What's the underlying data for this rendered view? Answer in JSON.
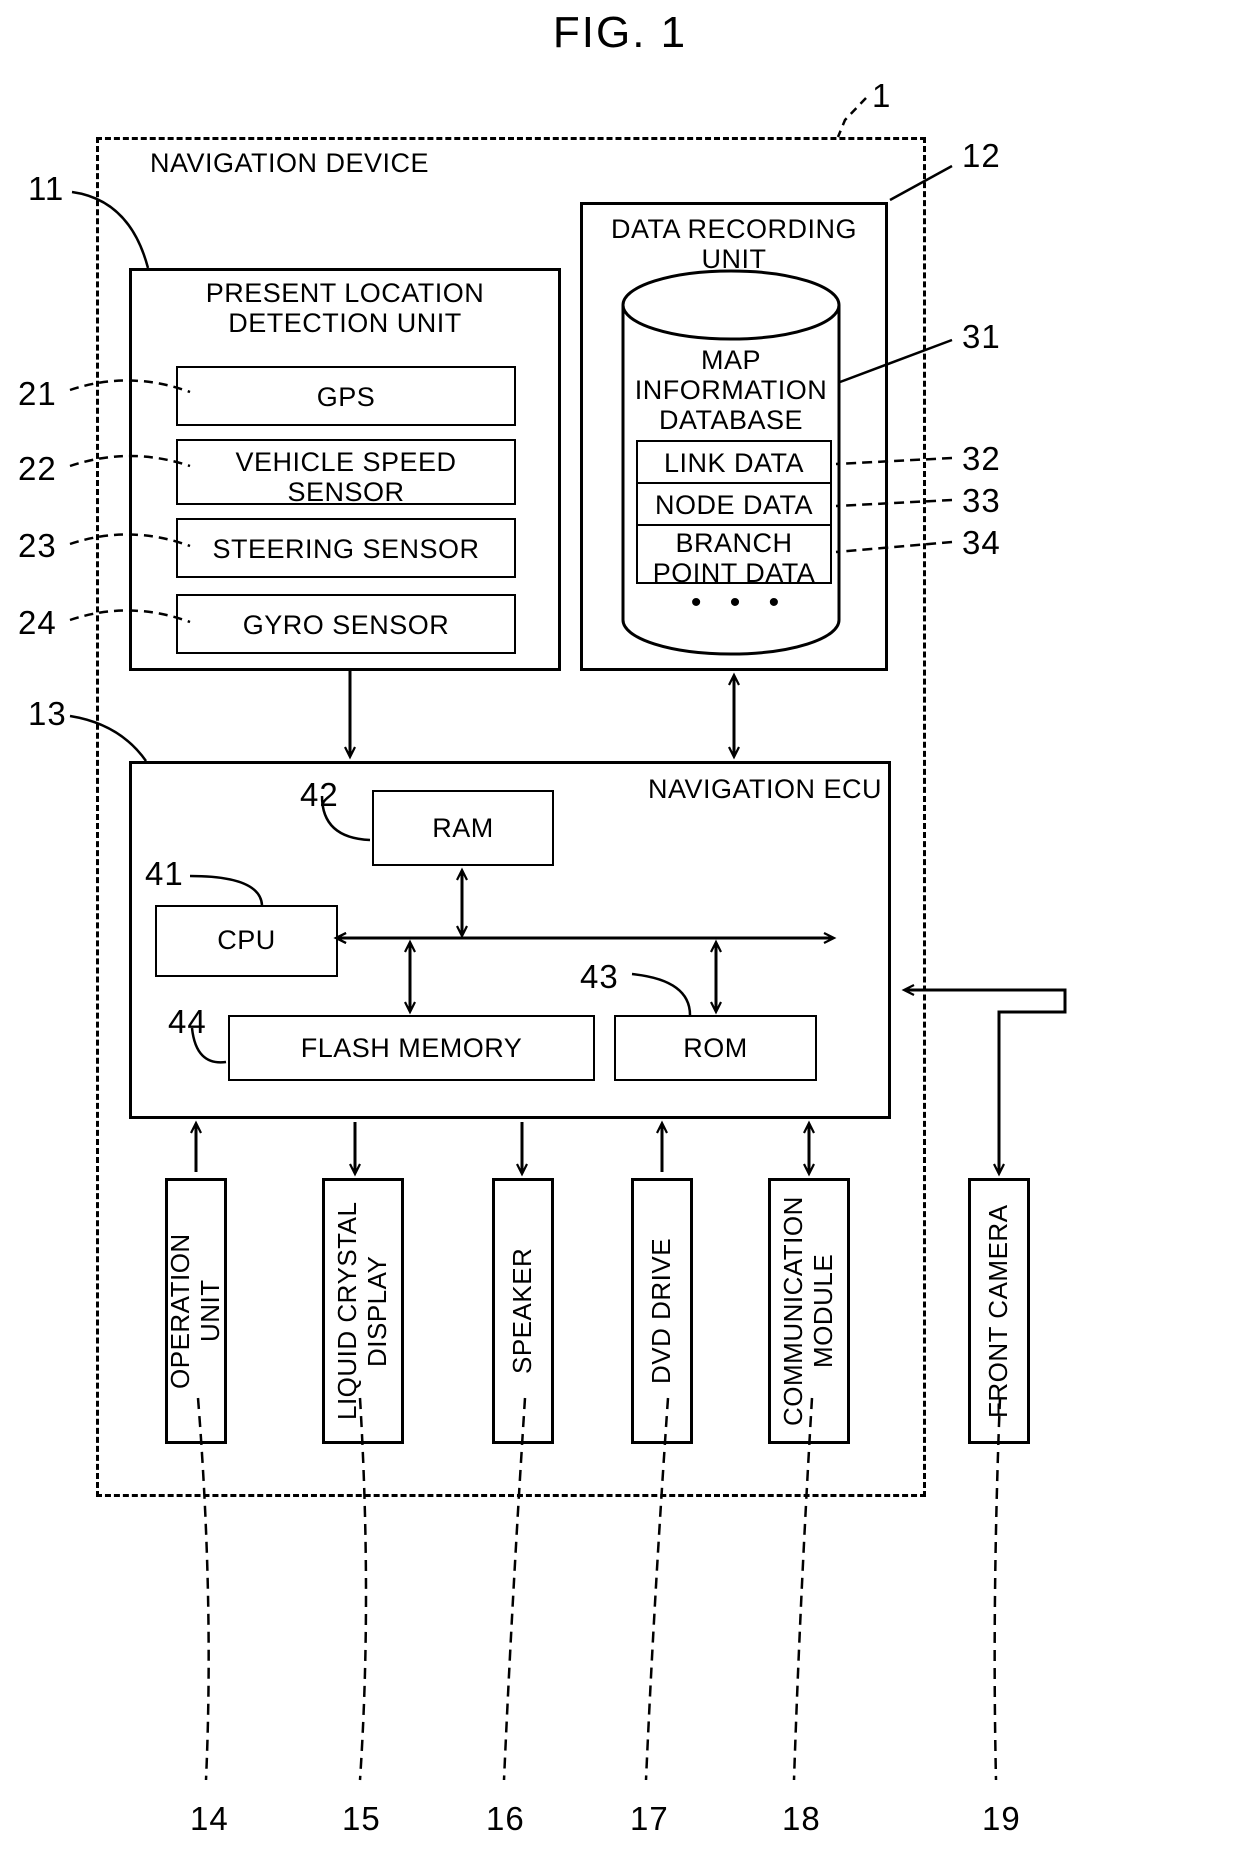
{
  "figure": {
    "title": "FIG. 1",
    "system_ref": "1",
    "outer_label": "NAVIGATION DEVICE"
  },
  "blocks": {
    "present_location_unit": {
      "label": "PRESENT LOCATION\nDETECTION UNIT",
      "ref": "11"
    },
    "gps": {
      "label": "GPS",
      "ref": "21"
    },
    "vehicle_speed": {
      "label": "VEHICLE SPEED\nSENSOR",
      "ref": "22"
    },
    "steering": {
      "label": "STEERING SENSOR",
      "ref": "23"
    },
    "gyro": {
      "label": "GYRO SENSOR",
      "ref": "24"
    },
    "data_recording_unit": {
      "label": "DATA RECORDING\nUNIT",
      "ref": "12"
    },
    "map_db": {
      "label": "MAP\nINFORMATION\nDATABASE",
      "ref": "31"
    },
    "link_data": {
      "label": "LINK DATA",
      "ref": "32"
    },
    "node_data": {
      "label": "NODE DATA",
      "ref": "33"
    },
    "branch_point": {
      "label": "BRANCH\nPOINT DATA",
      "ref": "34"
    },
    "db_ellipsis": {
      "label": "•  •  •"
    },
    "nav_ecu": {
      "label": "NAVIGATION ECU",
      "ref": "13"
    },
    "ram": {
      "label": "RAM",
      "ref": "42"
    },
    "cpu": {
      "label": "CPU",
      "ref": "41"
    },
    "flash_memory": {
      "label": "FLASH MEMORY",
      "ref": "44"
    },
    "rom": {
      "label": "ROM",
      "ref": "43"
    },
    "operation_unit": {
      "label": "OPERATION\nUNIT",
      "ref": "14"
    },
    "liquid_crystal": {
      "label": "LIQUID CRYSTAL\nDISPLAY",
      "ref": "15"
    },
    "speaker": {
      "label": "SPEAKER",
      "ref": "16"
    },
    "dvd_drive": {
      "label": "DVD DRIVE",
      "ref": "17"
    },
    "communication_module": {
      "label": "COMMUNICATION\nMODULE",
      "ref": "18"
    },
    "front_camera": {
      "label": "FRONT CAMERA",
      "ref": "19"
    }
  },
  "colors": {
    "ink": "#000000",
    "paper": "#ffffff"
  }
}
